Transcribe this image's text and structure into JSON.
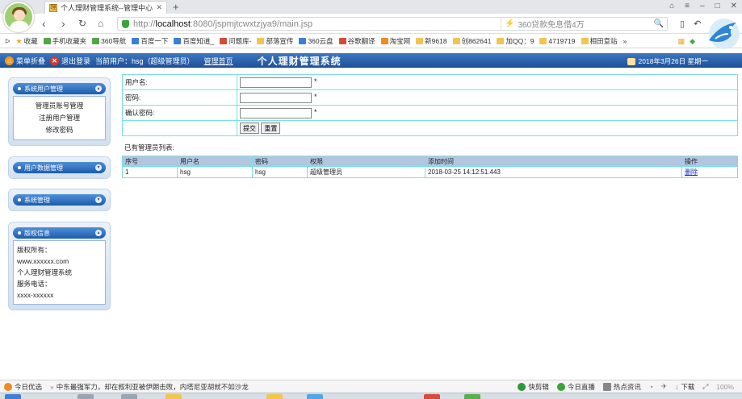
{
  "browser": {
    "tab_title": "个人理财管理系统--管理中心",
    "tab_favicon": "理",
    "url_host": "localhost",
    "url_rest": ":8080/jspmjtcwxtzjya9/main.jsp",
    "url_prefix": "http://",
    "search_placeholder": "360贷款免息借4万",
    "bookmarks": [
      {
        "label": "收藏",
        "icon": "star"
      },
      {
        "label": "手机收藏夹",
        "icon": "green"
      },
      {
        "label": "360导航",
        "icon": "green"
      },
      {
        "label": "百度一下",
        "icon": "blue"
      },
      {
        "label": "百度知道_",
        "icon": "blue"
      },
      {
        "label": "问题库-",
        "icon": "red"
      },
      {
        "label": "部落宣传",
        "icon": "folder"
      },
      {
        "label": "360云盘",
        "icon": "blue"
      },
      {
        "label": "谷歌翻译",
        "icon": "red"
      },
      {
        "label": "淘宝网",
        "icon": "orange"
      },
      {
        "label": "新9618",
        "icon": "folder"
      },
      {
        "label": "创862641",
        "icon": "folder"
      },
      {
        "label": "加QQ：9",
        "icon": "folder"
      },
      {
        "label": "4719719",
        "icon": "folder"
      },
      {
        "label": "相田意站",
        "icon": "folder"
      }
    ],
    "more_label": "»"
  },
  "header": {
    "home_label": "菜单折叠",
    "exit_label": "退出登录",
    "current_user": "当前用户：hsg（超级管理员）",
    "main_link": "管理首页",
    "title": "个人理财管理系统",
    "date": "2018年3月26日 星期一"
  },
  "menu": {
    "user_mgmt": {
      "title": "系统用户管理",
      "items": [
        "管理员账号管理",
        "注册用户管理",
        "修改密码"
      ]
    },
    "user_data": {
      "title": "用户数据管理"
    },
    "sys_mgmt": {
      "title": "系统管理"
    },
    "copyright": {
      "title": "版权信息",
      "lines": [
        "版权所有：",
        "www.xxxxxx.com",
        "个人理财管理系统",
        "服务电话：",
        "xxxx-xxxxxx"
      ]
    }
  },
  "form": {
    "username_label": "用户名:",
    "password_label": "密码:",
    "confirm_label": "确认密码:",
    "required_mark": "*",
    "username_value": "",
    "password_value": "",
    "confirm_value": "",
    "submit_label": "提交",
    "reset_label": "重置"
  },
  "list": {
    "caption": "已有管理员列表:",
    "headers": [
      "序号",
      "用户名",
      "密码",
      "权限",
      "添加时间",
      "操作"
    ],
    "rows": [
      {
        "no": "1",
        "username": "hsg",
        "password": "hsg",
        "role": "超级管理员",
        "added": "2018-03-25 14:12:51.443",
        "action": "删除"
      }
    ]
  },
  "status": {
    "today": "今日优选",
    "news": "中东最强军力，却在叙利亚被伊朗击败，内塔尼亚胡就不如沙龙",
    "clip": "快剪辑",
    "live": "今日直播",
    "hot": "热点资讯",
    "download": "下载",
    "zoom": "100%"
  },
  "colors": {
    "header_blue": "#1d4f98",
    "table_border": "#7adfe8",
    "grid_header": "#b3c6e0",
    "link": "#1230c8"
  }
}
